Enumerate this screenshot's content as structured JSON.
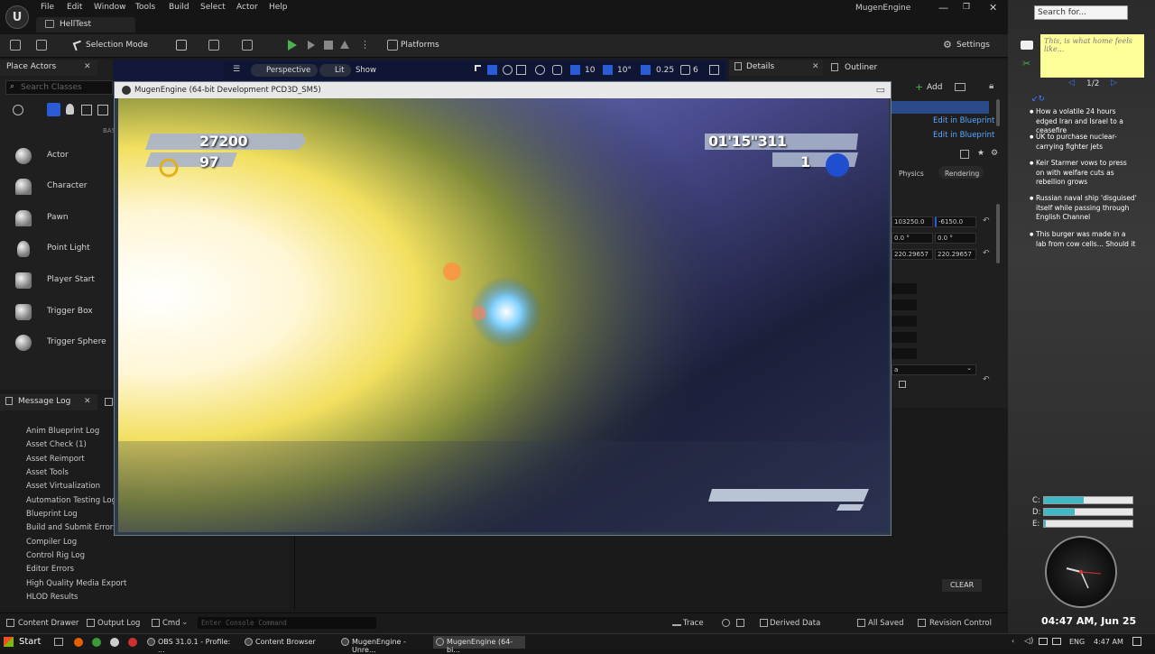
{
  "editor": {
    "title": "MugenEngine",
    "project_tab": "HellTest",
    "menu": [
      "File",
      "Edit",
      "Window",
      "Tools",
      "Build",
      "Select",
      "Actor",
      "Help"
    ],
    "window_controls": [
      "—",
      "❐",
      "✕"
    ]
  },
  "toolbar": {
    "selection_mode": "Selection Mode",
    "platforms": "Platforms",
    "settings": "Settings"
  },
  "place_actors": {
    "tab": "Place Actors",
    "search_placeholder": "Search Classes",
    "basic_label": "BAS",
    "items": [
      "Actor",
      "Character",
      "Pawn",
      "Point Light",
      "Player Start",
      "Trigger Box",
      "Trigger Sphere"
    ]
  },
  "viewport": {
    "perspective": "Perspective",
    "lit": "Lit",
    "show": "Show",
    "grid_snap": "10",
    "rotation_snap": "10°",
    "scale_snap": "0.25",
    "camera_speed": "6"
  },
  "details": {
    "tab": "Details",
    "outliner_tab": "Outliner",
    "add": "Add",
    "edit_blueprint_1": "Edit in Blueprint",
    "edit_blueprint_2": "Edit in Blueprint",
    "physics_tab": "Physics",
    "rendering_tab": "Rendering",
    "loc_x": "103250.0",
    "loc_y": "-6150.0",
    "rot_x": "0.0 °",
    "rot_y": "0.0 °",
    "scale_x": "220.29657",
    "scale_y": "220.29657",
    "dropdown_partial": "a"
  },
  "message_log": {
    "tab": "Message Log",
    "items": [
      "Anim Blueprint Log",
      "Asset Check (1)",
      "Asset Reimport",
      "Asset Tools",
      "Asset Virtualization",
      "Automation Testing Log",
      "Blueprint Log",
      "Build and Submit Errors",
      "Compiler Log",
      "Control Rig Log",
      "Editor Errors",
      "High Quality Media Export",
      "HLOD Results"
    ],
    "clear": "CLEAR"
  },
  "statusbar": {
    "content_drawer": "Content Drawer",
    "output_log": "Output Log",
    "cmd": "Cmd",
    "console_placeholder": "Enter Console Command",
    "trace": "Trace",
    "derived_data": "Derived Data",
    "all_saved": "All Saved",
    "revision_control": "Revision Control"
  },
  "game": {
    "window_title": "MugenEngine (64-bit Development PCD3D_SM5)",
    "score": "27200",
    "rings": "97",
    "time": "01'15\"311",
    "lives": "1"
  },
  "desktop": {
    "search_placeholder": "Search for...",
    "sticky_note": "This, is what home feels like...",
    "news_page": "1/2",
    "news": [
      "How a volatile 24 hours edged Iran and Israel to a ceasefire",
      "UK to purchase nuclear-carrying fighter jets",
      "Keir Starmer vows to press on with welfare cuts as rebellion grows",
      "Russian naval ship 'disguised' itself while passing through English Channel",
      "This burger was made in a lab from cow cells... Should it"
    ],
    "drives": [
      {
        "label": "C:",
        "fill": 0.45
      },
      {
        "label": "D:",
        "fill": 0.35
      },
      {
        "label": "E:",
        "fill": 0.02
      }
    ],
    "datetime": "04:47 AM, Jun 25"
  },
  "taskbar": {
    "start": "Start",
    "tasks": [
      "OBS 31.0.1 - Profile: ...",
      "Content Browser",
      "MugenEngine - Unre...",
      "MugenEngine (64-bi..."
    ],
    "lang": "ENG",
    "time": "4:47 AM"
  },
  "colors": {
    "accent_green": "#4caf50",
    "link_blue": "#5aa7ff",
    "drive_fill": "#3fb8c8"
  }
}
